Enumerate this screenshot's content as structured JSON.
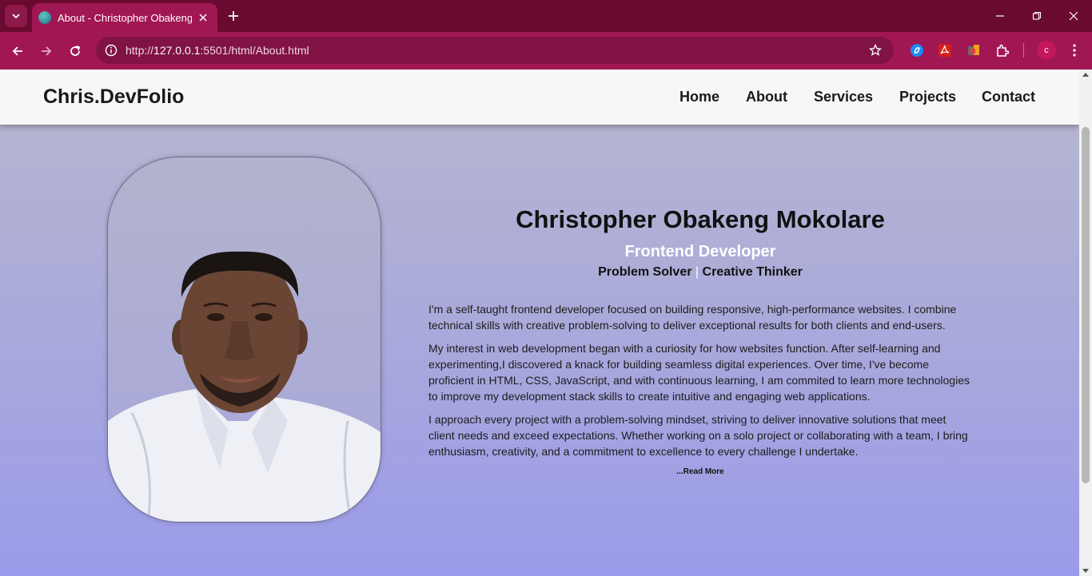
{
  "browser": {
    "tab_title": "About - Christopher Obakeng Mokolare",
    "url_prefix": "http://",
    "url_host": "127.0.0.1",
    "url_path": ":5501/html/About.html",
    "profile_initial": "c",
    "icons": [
      "chevron-down-icon",
      "close-icon",
      "plus-icon",
      "minimize-icon",
      "restore-icon",
      "back-icon",
      "forward-icon",
      "reload-icon",
      "site-info-icon",
      "star-icon",
      "extensions-icon",
      "kebab-menu-icon"
    ]
  },
  "site": {
    "logo": "Chris.DevFolio",
    "nav": [
      "Home",
      "About",
      "Services",
      "Projects",
      "Contact"
    ]
  },
  "about": {
    "name": "Christopher Obakeng Mokolare",
    "role": "Frontend Developer",
    "tagline_a": "Problem Solver",
    "tagline_sep": "|",
    "tagline_b": "Creative Thinker",
    "paragraphs": [
      "I'm a self-taught frontend developer focused on building responsive, high-performance websites. I combine technical skills with creative problem-solving to deliver exceptional results for both clients and end-users.",
      "My interest in web development began with a curiosity for how websites function. After self-learning and experimenting,I discovered a knack for building seamless digital experiences. Over time, I've become proficient in HTML, CSS, JavaScript, and with continuous learning, I am commited to learn more technologies to improve my development stack skills to create intuitive and engaging web applications.",
      "I approach every project with a problem-solving mindset, striving to deliver innovative solutions that meet client needs and exceed expectations. Whether working on a solo project or collaborating with a team, I bring enthusiasm, creativity, and a commitment to excellence to every challenge I undertake."
    ],
    "read_more": "...Read More"
  },
  "colors": {
    "tabbar": "#6b0a30",
    "toolbar": "#a11754",
    "page_gradient_top": "#b8b8cf",
    "page_gradient_bottom": "#9b9beb"
  }
}
